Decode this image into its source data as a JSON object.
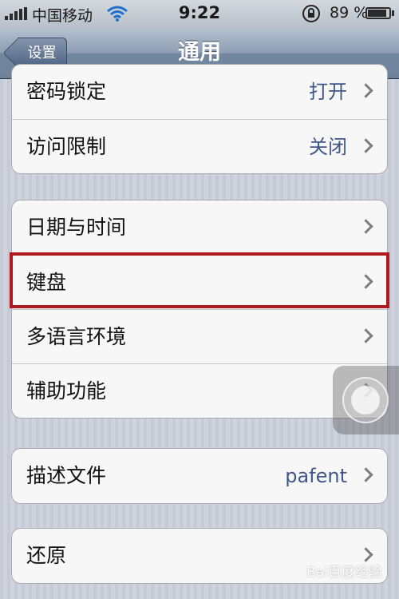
{
  "status_bar": {
    "carrier": "中国移动",
    "time": "9:22",
    "battery_percent": "89 %",
    "battery_level": 0.89,
    "icons": [
      "signal-bars-icon",
      "wifi-icon",
      "rotation-lock-icon",
      "battery-icon"
    ]
  },
  "nav": {
    "back_label": "设置",
    "title": "通用"
  },
  "groups": [
    {
      "rows": [
        {
          "label": "密码锁定",
          "value": "打开"
        },
        {
          "label": "访问限制",
          "value": "关闭"
        }
      ]
    },
    {
      "rows": [
        {
          "label": "日期与时间",
          "value": ""
        },
        {
          "label": "键盘",
          "value": "",
          "highlighted": true
        },
        {
          "label": "多语言环境",
          "value": ""
        },
        {
          "label": "辅助功能",
          "value": ""
        }
      ]
    },
    {
      "rows": [
        {
          "label": "描述文件",
          "value": "pafent"
        }
      ]
    },
    {
      "rows": [
        {
          "label": "还原",
          "value": ""
        }
      ]
    }
  ],
  "watermark": "Bai百度经验",
  "colors": {
    "highlight": "#b0191d",
    "value_text": "#3f5788",
    "nav_bar": "#7387a1"
  }
}
